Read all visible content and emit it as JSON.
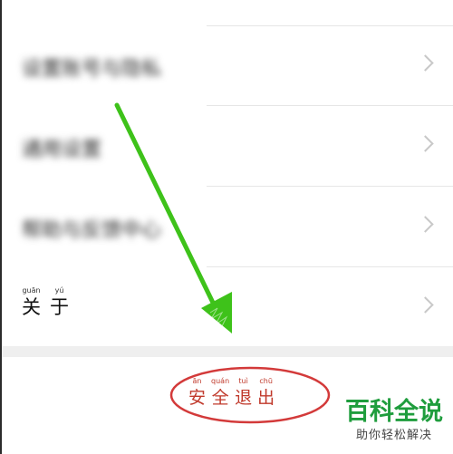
{
  "settings": {
    "items": [
      {
        "label": "设置账号与隐私",
        "blurred": true,
        "icon": "chevron-right-icon"
      },
      {
        "label": "通用设置",
        "blurred": true,
        "icon": "chevron-right-icon"
      },
      {
        "label": "帮助与反馈中心",
        "blurred": true,
        "icon": "chevron-right-icon"
      },
      {
        "label": "关于",
        "blurred": false,
        "icon": "chevron-right-icon",
        "chars": [
          {
            "hanzi": "关",
            "pinyin": "guān"
          },
          {
            "hanzi": "于",
            "pinyin": "yú"
          }
        ]
      }
    ]
  },
  "logout": {
    "label": "安全退出",
    "chars": [
      {
        "hanzi": "安",
        "pinyin": "ān"
      },
      {
        "hanzi": "全",
        "pinyin": "quán"
      },
      {
        "hanzi": "退",
        "pinyin": "tuì"
      },
      {
        "hanzi": "出",
        "pinyin": "chū"
      }
    ],
    "color": "#c0392b"
  },
  "annotations": {
    "arrow_color": "#3ec21a",
    "circle_color": "#d33a3a"
  },
  "watermark": {
    "title": "百科全说",
    "subtitle": "助你轻松解决",
    "color": "#1f9d3d"
  }
}
